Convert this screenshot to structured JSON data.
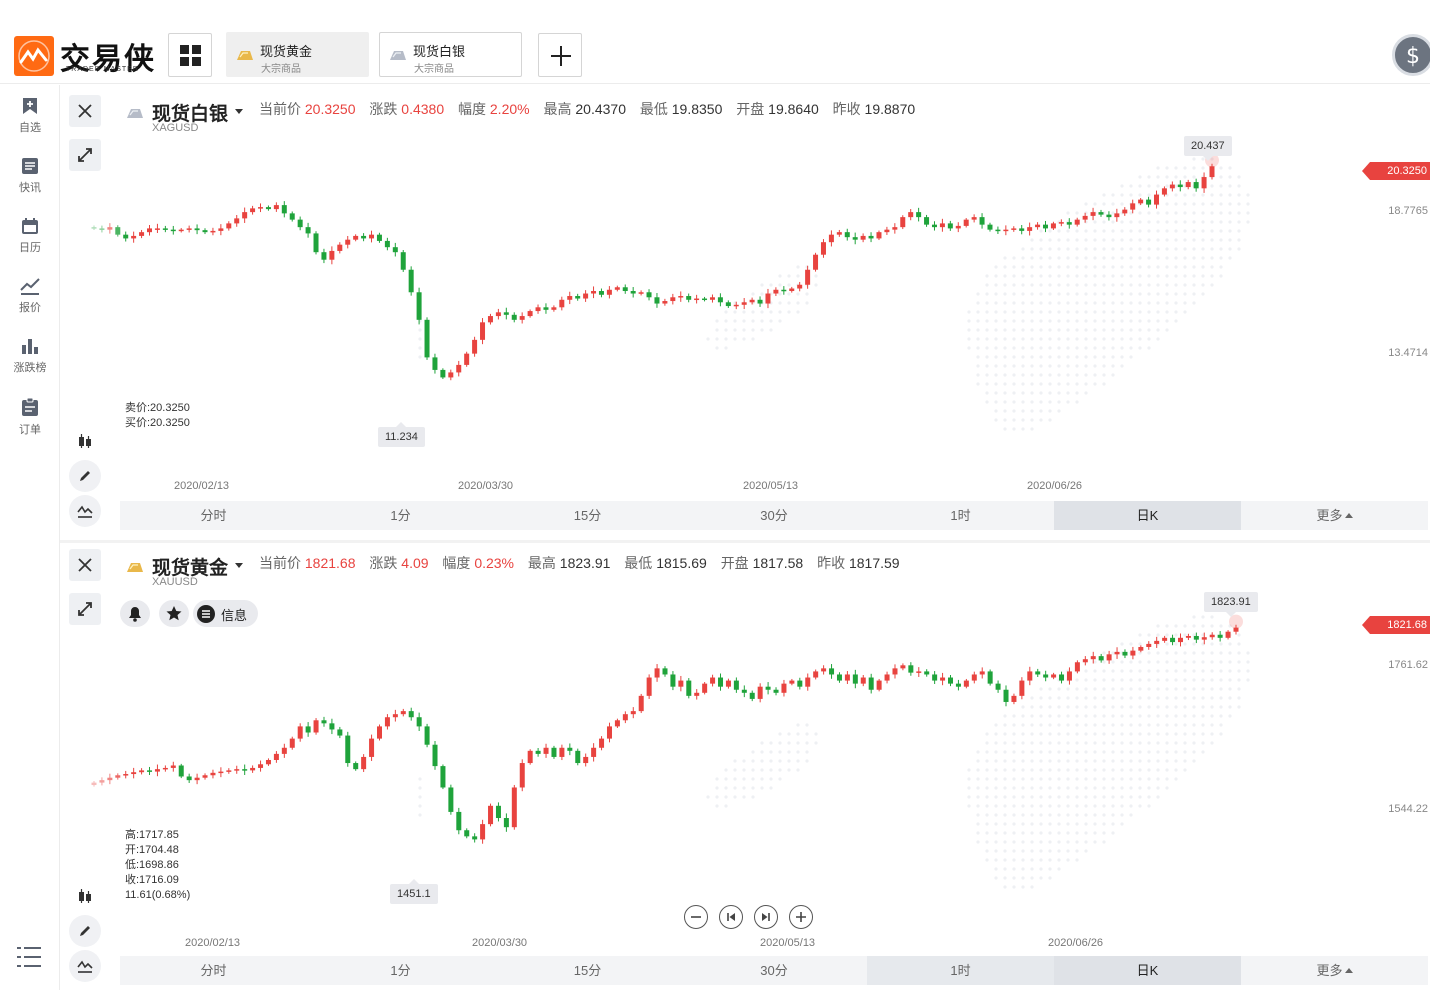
{
  "header": {
    "logo_cn": "交易侠",
    "logo_en": "TRADER MASTER",
    "tabs": [
      {
        "name": "现货黄金",
        "sub": "大宗商品"
      },
      {
        "name": "现货白银",
        "sub": "大宗商品"
      }
    ]
  },
  "sidebar": {
    "items": [
      {
        "label": "自选",
        "icon": "bookmark-add-icon"
      },
      {
        "label": "快讯",
        "icon": "news-icon"
      },
      {
        "label": "日历",
        "icon": "calendar-icon"
      },
      {
        "label": "报价",
        "icon": "line-chart-icon"
      },
      {
        "label": "涨跌榜",
        "icon": "bar-chart-icon"
      },
      {
        "label": "订单",
        "icon": "clipboard-icon"
      }
    ]
  },
  "colors": {
    "up": "#e8433f",
    "down": "#1fa33b",
    "accent": "#ff6a13"
  },
  "timeframes": [
    "分时",
    "1分",
    "15分",
    "30分",
    "1时",
    "日K",
    "更多"
  ],
  "panels": {
    "silver": {
      "name": "现货白银",
      "code": "XAGUSD",
      "stats": {
        "current_label": "当前价",
        "current": "20.3250",
        "change_label": "涨跌",
        "change": "0.4380",
        "pct_label": "幅度",
        "pct": "2.20%",
        "high_label": "最高",
        "high": "20.4370",
        "low_label": "最低",
        "low": "19.8350",
        "open_label": "开盘",
        "open": "19.8640",
        "prev_label": "昨收",
        "prev": "19.8870"
      },
      "sell_line": "卖价:20.3250",
      "buy_line": "买价:20.3250",
      "price_tag": "20.3250",
      "axis": [
        "18.7765",
        "13.4714"
      ],
      "dates": [
        "2020/02/13",
        "2020/03/30",
        "2020/05/13",
        "2020/06/26"
      ],
      "max_callout": "20.437",
      "min_callout": "11.234",
      "active_tf": "日K"
    },
    "gold": {
      "name": "现货黄金",
      "code": "XAUUSD",
      "stats": {
        "current_label": "当前价",
        "current": "1821.68",
        "change_label": "涨跌",
        "change": "4.09",
        "pct_label": "幅度",
        "pct": "0.23%",
        "high_label": "最高",
        "high": "1823.91",
        "low_label": "最低",
        "low": "1815.69",
        "open_label": "开盘",
        "open": "1817.58",
        "prev_label": "昨收",
        "prev": "1817.59"
      },
      "info_label": "信息",
      "ohlc": {
        "high": "高:1717.85",
        "open": "开:1704.48",
        "low": "低:1698.86",
        "close": "收:1716.09",
        "change": "11.61(0.68%)"
      },
      "price_tag": "1821.68",
      "axis": [
        "1761.62",
        "1544.22"
      ],
      "dates": [
        "2020/02/13",
        "2020/03/30",
        "2020/05/13",
        "2020/06/26"
      ],
      "max_callout": "1823.91",
      "min_callout": "1451.1",
      "active_tf": "日K"
    }
  },
  "chart_data": [
    {
      "type": "candlestick",
      "title": "现货白银",
      "period": "日K",
      "x_labels": [
        "2020/02/13",
        "2020/03/30",
        "2020/05/13",
        "2020/06/26"
      ],
      "y_ticks": [
        18.7765,
        13.4714
      ],
      "ylim": [
        10.4,
        21.1
      ],
      "close": [
        17.85,
        17.8,
        17.9,
        17.6,
        17.45,
        17.55,
        17.7,
        17.85,
        17.85,
        17.8,
        17.75,
        17.8,
        17.85,
        17.78,
        17.7,
        17.75,
        17.85,
        18.05,
        18.25,
        18.5,
        18.65,
        18.7,
        18.62,
        18.78,
        18.45,
        18.2,
        17.9,
        17.65,
        16.9,
        16.6,
        16.95,
        17.2,
        17.4,
        17.55,
        17.45,
        17.6,
        17.35,
        17.1,
        16.9,
        16.2,
        15.3,
        14.2,
        12.7,
        12.2,
        11.9,
        12.1,
        12.4,
        12.85,
        13.4,
        14.1,
        14.35,
        14.5,
        14.4,
        14.2,
        14.35,
        14.55,
        14.7,
        14.6,
        14.7,
        15.0,
        15.15,
        15.05,
        15.25,
        15.35,
        15.2,
        15.4,
        15.5,
        15.35,
        15.25,
        15.3,
        15.1,
        14.85,
        14.95,
        15.1,
        15.15,
        15.0,
        15.05,
        15.0,
        15.1,
        14.9,
        14.75,
        14.8,
        14.9,
        15.0,
        14.85,
        15.25,
        15.4,
        15.35,
        15.45,
        15.6,
        16.2,
        16.8,
        17.3,
        17.6,
        17.7,
        17.5,
        17.4,
        17.55,
        17.45,
        17.7,
        17.8,
        17.9,
        18.3,
        18.5,
        18.3,
        18.0,
        17.9,
        18.05,
        17.85,
        17.95,
        18.2,
        18.3,
        18.0,
        17.8,
        17.75,
        17.8,
        17.85,
        17.75,
        17.9,
        18.0,
        17.85,
        18.05,
        18.1,
        18.0,
        18.2,
        18.35,
        18.5,
        18.4,
        18.3,
        18.45,
        18.6,
        18.85,
        19.0,
        18.8,
        19.2,
        19.45,
        19.6,
        19.5,
        19.7,
        19.45,
        19.9,
        20.33
      ]
    },
    {
      "type": "candlestick",
      "title": "现货黄金",
      "period": "日K",
      "x_labels": [
        "2020/02/13",
        "2020/03/30",
        "2020/05/13",
        "2020/06/26"
      ],
      "y_ticks": [
        1761.62,
        1544.22
      ],
      "ylim": [
        1420,
        1862
      ],
      "close": [
        1568,
        1572,
        1576,
        1580,
        1582,
        1585,
        1588,
        1586,
        1590,
        1592,
        1596,
        1578,
        1572,
        1576,
        1580,
        1584,
        1586,
        1588,
        1590,
        1588,
        1592,
        1598,
        1605,
        1615,
        1625,
        1640,
        1660,
        1650,
        1670,
        1665,
        1655,
        1645,
        1600,
        1590,
        1610,
        1640,
        1660,
        1675,
        1680,
        1685,
        1675,
        1660,
        1630,
        1595,
        1560,
        1520,
        1490,
        1480,
        1475,
        1500,
        1530,
        1510,
        1495,
        1560,
        1600,
        1620,
        1615,
        1625,
        1610,
        1625,
        1620,
        1600,
        1610,
        1625,
        1640,
        1660,
        1670,
        1680,
        1685,
        1710,
        1740,
        1755,
        1745,
        1725,
        1735,
        1710,
        1715,
        1730,
        1740,
        1725,
        1735,
        1720,
        1715,
        1705,
        1725,
        1720,
        1715,
        1730,
        1735,
        1725,
        1740,
        1750,
        1755,
        1745,
        1735,
        1745,
        1730,
        1740,
        1720,
        1735,
        1745,
        1755,
        1760,
        1748,
        1750,
        1745,
        1735,
        1740,
        1730,
        1725,
        1735,
        1745,
        1750,
        1730,
        1720,
        1700,
        1710,
        1735,
        1750,
        1745,
        1740,
        1745,
        1735,
        1750,
        1765,
        1770,
        1775,
        1768,
        1778,
        1782,
        1776,
        1784,
        1790,
        1795,
        1800,
        1805,
        1798,
        1805,
        1808,
        1802,
        1806,
        1810,
        1805,
        1815,
        1821.68
      ]
    }
  ]
}
